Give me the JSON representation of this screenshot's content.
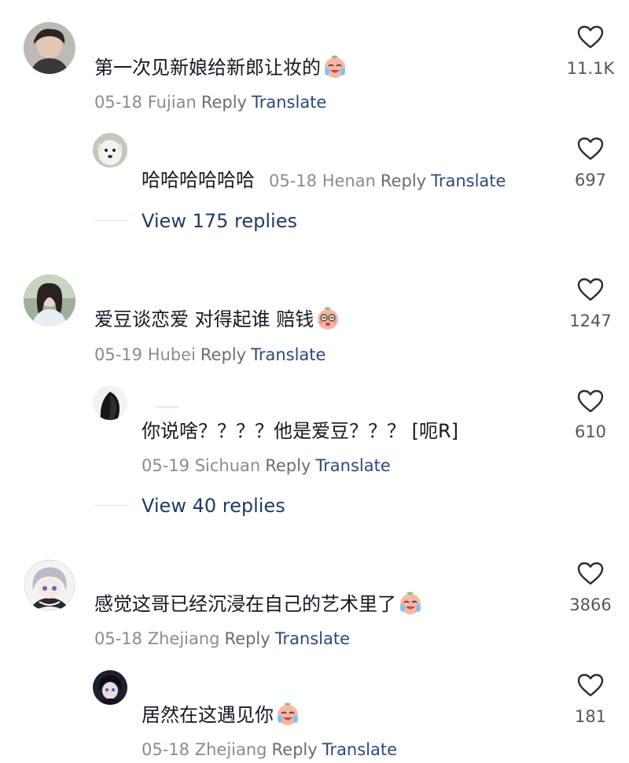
{
  "comments": [
    {
      "text": "第一次见新娘给新郎让妆的",
      "date": "05-18",
      "location": "Fujian",
      "reply_label": "Reply",
      "translate_label": "Translate",
      "likes": "11.1K",
      "emoji": "crying-laugh-emoji"
    },
    {
      "text": "哈哈哈哈哈哈",
      "date": "05-18",
      "location": "Henan",
      "reply_label": "Reply",
      "translate_label": "Translate",
      "likes": "697"
    },
    {
      "view_replies": "View 175 replies"
    },
    {
      "text": "爱豆谈恋爱 对得起谁 赔钱",
      "date": "05-19",
      "location": "Hubei",
      "reply_label": "Reply",
      "translate_label": "Translate",
      "likes": "1247",
      "emoji": "dizzy-emoji"
    },
    {
      "text": "你说啥？？？？他是爱豆？？？ [呃R]",
      "date": "05-19",
      "location": "Sichuan",
      "reply_label": "Reply",
      "translate_label": "Translate",
      "likes": "610"
    },
    {
      "view_replies": "View 40 replies"
    },
    {
      "text": "感觉这哥已经沉浸在自己的艺术里了",
      "date": "05-18",
      "location": "Zhejiang",
      "reply_label": "Reply",
      "translate_label": "Translate",
      "likes": "3866",
      "emoji": "crying-laugh-emoji"
    },
    {
      "text": "居然在这遇见你",
      "date": "05-18",
      "location": "Zhejiang",
      "reply_label": "Reply",
      "translate_label": "Translate",
      "likes": "181",
      "emoji": "crying-laugh-emoji"
    }
  ],
  "colors": {
    "link": "#2b4a7a",
    "view_replies": "#1f3c66",
    "meta": "#8a8b91",
    "text": "#161823"
  }
}
